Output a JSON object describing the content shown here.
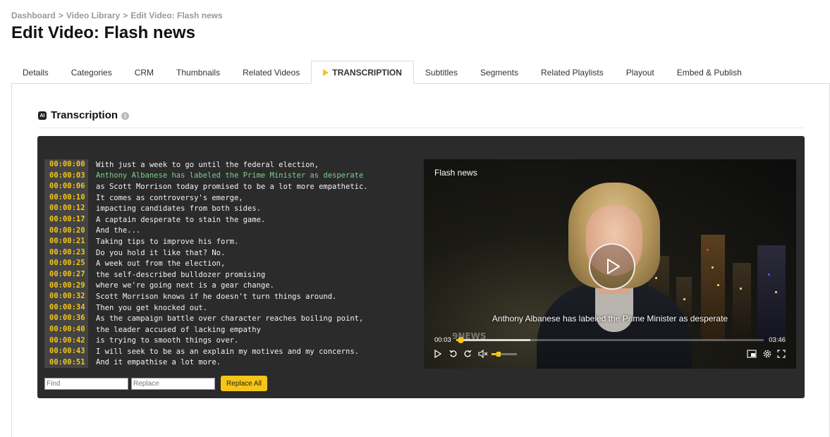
{
  "breadcrumb": {
    "items": [
      "Dashboard",
      "Video Library"
    ],
    "current": "Edit Video: Flash news",
    "separator": ">"
  },
  "page": {
    "title": "Edit Video: Flash news"
  },
  "tabs": [
    {
      "label": "Details"
    },
    {
      "label": "Categories"
    },
    {
      "label": "CRM"
    },
    {
      "label": "Thumbnails"
    },
    {
      "label": "Related Videos"
    },
    {
      "label": "TRANSCRIPTION",
      "active": true
    },
    {
      "label": "Subtitles"
    },
    {
      "label": "Segments"
    },
    {
      "label": "Related Playlists"
    },
    {
      "label": "Playout"
    },
    {
      "label": "Embed & Publish"
    }
  ],
  "section": {
    "title": "Transcription",
    "ai_icon_text": "AI",
    "info_icon": "i"
  },
  "transcript": [
    {
      "time": "00:00:00",
      "text": "With just a week to go until the federal election,"
    },
    {
      "time": "00:00:03",
      "text": "Anthony Albanese has labeled the Prime Minister as desperate",
      "highlight": true
    },
    {
      "time": "00:00:06",
      "text": "as Scott Morrison today promised to be a lot more empathetic."
    },
    {
      "time": "00:00:10",
      "text": "It comes as controversy's emerge,"
    },
    {
      "time": "00:00:12",
      "text": "impacting candidates from both sides."
    },
    {
      "time": "00:00:17",
      "text": "A captain desperate to stain the game."
    },
    {
      "time": "00:00:20",
      "text": "And the..."
    },
    {
      "time": "00:00:21",
      "text": "Taking tips to improve his form."
    },
    {
      "time": "00:00:23",
      "text": "Do you hold it like that? No."
    },
    {
      "time": "00:00:25",
      "text": "A week out from the election,"
    },
    {
      "time": "00:00:27",
      "text": "the self-described bulldozer promising"
    },
    {
      "time": "00:00:29",
      "text": "where we're going next is a gear change."
    },
    {
      "time": "00:00:32",
      "text": "Scott Morrison knows if he doesn't turn things around."
    },
    {
      "time": "00:00:34",
      "text": "Then you get knocked out."
    },
    {
      "time": "00:00:36",
      "text": "As the campaign battle over character reaches boiling point,"
    },
    {
      "time": "00:00:40",
      "text": "the leader accused of lacking empathy"
    },
    {
      "time": "00:00:42",
      "text": "is trying to smooth things over."
    },
    {
      "time": "00:00:43",
      "text": "I will seek to be as an explain my motives and my concerns."
    },
    {
      "time": "00:00:51",
      "text": "And it empathise a lot more."
    }
  ],
  "find_replace": {
    "find_placeholder": "Find",
    "replace_placeholder": "Replace",
    "button_label": "Replace All"
  },
  "video": {
    "title": "Flash news",
    "subtitle": "Anthony Albanese has labeled the Prime Minister as desperate",
    "current_time": "00:03",
    "duration": "03:46",
    "progress_fraction": 0.0133,
    "buffered_fraction": 0.24,
    "volume_fraction": 0.2,
    "watermark": "9NEWS",
    "controls": [
      "play-icon",
      "rewind-icon",
      "forward-icon",
      "mute-icon",
      "pip-icon",
      "settings-icon",
      "fullscreen-icon"
    ]
  },
  "colors": {
    "accent": "#f5c518",
    "highlight_text": "#79d18a",
    "dark_bg": "#2b2b2b"
  }
}
